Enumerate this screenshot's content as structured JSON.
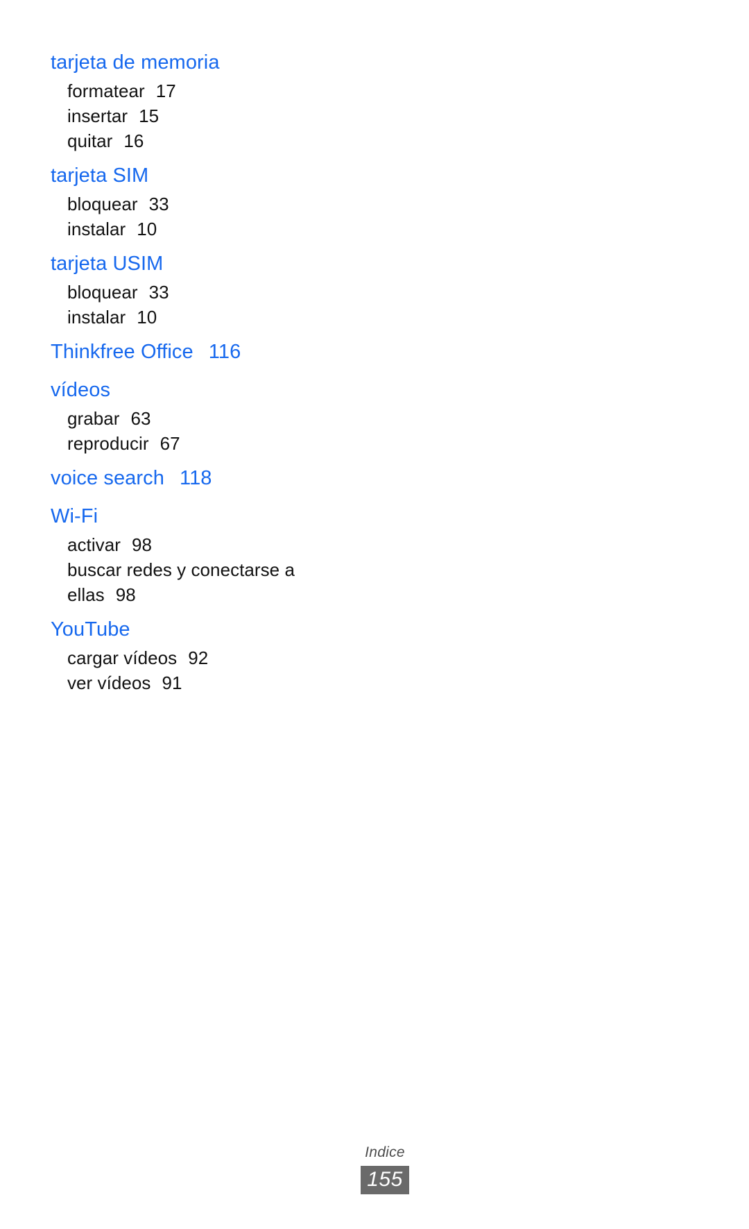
{
  "document": {
    "language": "es",
    "heading_color": "#1668ee",
    "body_color": "#111111",
    "background_color": "#ffffff"
  },
  "index": {
    "groups": [
      {
        "heading": "tarjeta de memoria",
        "heading_page": "",
        "entries": [
          {
            "label": "formatear",
            "page": "17"
          },
          {
            "label": "insertar",
            "page": "15"
          },
          {
            "label": "quitar",
            "page": "16"
          }
        ]
      },
      {
        "heading": "tarjeta SIM",
        "heading_page": "",
        "entries": [
          {
            "label": "bloquear",
            "page": "33"
          },
          {
            "label": "instalar",
            "page": "10"
          }
        ]
      },
      {
        "heading": "tarjeta USIM",
        "heading_page": "",
        "entries": [
          {
            "label": "bloquear",
            "page": "33"
          },
          {
            "label": "instalar",
            "page": "10"
          }
        ]
      },
      {
        "heading": "Thinkfree Office",
        "heading_page": "116",
        "entries": []
      },
      {
        "heading": "vídeos",
        "heading_page": "",
        "entries": [
          {
            "label": "grabar",
            "page": "63"
          },
          {
            "label": "reproducir",
            "page": "67"
          }
        ]
      },
      {
        "heading": "voice search",
        "heading_page": "118",
        "entries": []
      },
      {
        "heading": "Wi-Fi",
        "heading_page": "",
        "entries": [
          {
            "label": "activar",
            "page": "98"
          },
          {
            "label": "buscar redes y conectarse a ellas",
            "page": "98"
          }
        ]
      },
      {
        "heading": "YouTube",
        "heading_page": "",
        "entries": [
          {
            "label": "cargar vídeos",
            "page": "92"
          },
          {
            "label": "ver vídeos",
            "page": "91"
          }
        ]
      }
    ]
  },
  "footer": {
    "label": "Indice",
    "page_number": "155",
    "page_box_color": "#6a6a6a",
    "label_color": "#4c4c4c"
  }
}
